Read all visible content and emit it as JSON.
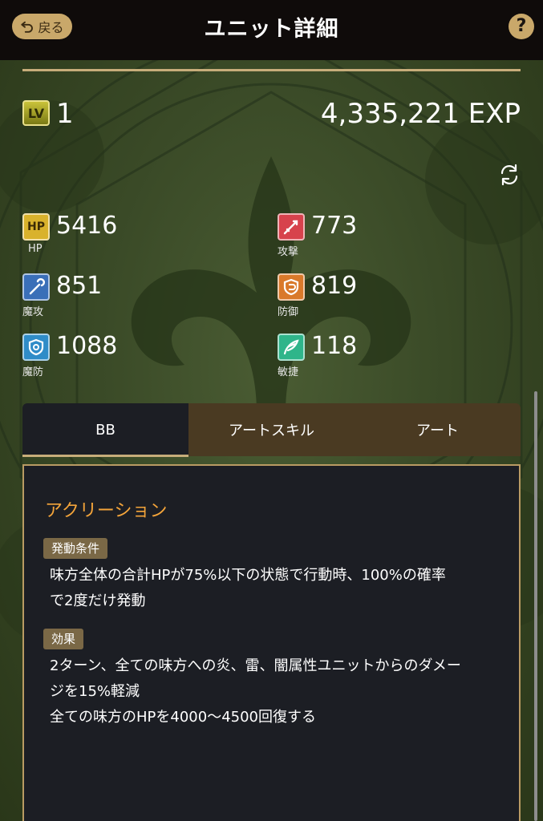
{
  "header": {
    "back_label": "戻る",
    "title": "ユニット詳細",
    "help_label": "?"
  },
  "level": {
    "badge": "LV",
    "value": "1",
    "exp": "4,335,221 EXP"
  },
  "stats": {
    "hp": {
      "icon_text": "HP",
      "label": "HP",
      "value": "5416",
      "icon": "hp-icon",
      "color": "#d9b22c"
    },
    "attack": {
      "label": "攻撃",
      "value": "773",
      "icon": "sword-icon",
      "color": "#d7424c"
    },
    "magic_attack": {
      "label": "魔攻",
      "value": "851",
      "icon": "staff-icon",
      "color": "#3a6fb8"
    },
    "defense": {
      "label": "防御",
      "value": "819",
      "icon": "shield-icon",
      "color": "#d9792a"
    },
    "magic_defense": {
      "label": "魔防",
      "value": "1088",
      "icon": "magic-shield-icon",
      "color": "#2f8cc8"
    },
    "agility": {
      "label": "敏捷",
      "value": "118",
      "icon": "wing-icon",
      "color": "#2fb58a"
    }
  },
  "tabs": [
    {
      "label": "BB",
      "active": true
    },
    {
      "label": "アートスキル",
      "active": false
    },
    {
      "label": "アート",
      "active": false
    }
  ],
  "skill": {
    "name": "アクリーション",
    "condition_tag": "発動条件",
    "condition_lines": [
      "味方全体の合計HPが75%以下の状態で行動時、100%の確率",
      "で2度だけ発動"
    ],
    "effect_tag": "効果",
    "effect_lines": [
      "2ターン、全ての味方への炎、雷、闇属性ユニットからのダメー",
      "ジを15%軽減",
      "全ての味方のHPを4000～4500回復する"
    ]
  },
  "colors": {
    "accent_gold": "#c7ad7a",
    "skill_name": "#f3a43a",
    "panel_bg": "#1c1e24"
  }
}
